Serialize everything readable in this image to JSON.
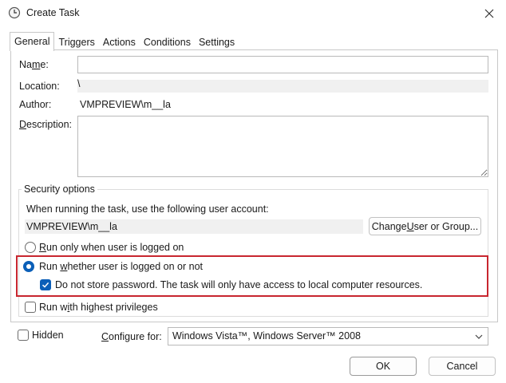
{
  "window": {
    "title": "Create Task"
  },
  "tabs": [
    {
      "label": "General",
      "active": true
    },
    {
      "label": "Triggers"
    },
    {
      "label": "Actions"
    },
    {
      "label": "Conditions"
    },
    {
      "label": "Settings"
    }
  ],
  "general": {
    "name_label_main": "Na",
    "name_label_mnemonic": "m",
    "name_label_rest": "e:",
    "name_value": "",
    "location_label": "Location:",
    "location_value": "\\",
    "author_label": "Author:",
    "author_value": "VMPREVIEW\\m__la",
    "description_label_mnemonic": "D",
    "description_label_rest": "escription:",
    "description_value": ""
  },
  "security": {
    "legend": "Security options",
    "account_prompt": "When running the task, use the following user account:",
    "account_value": "VMPREVIEW\\m__la",
    "change_btn": {
      "pre": "Change ",
      "mnemonic": "U",
      "post": "ser or Group..."
    },
    "opt_logged_on": {
      "mnemonic": "R",
      "rest": "un only when user is logged on",
      "selected": false
    },
    "opt_whether": {
      "pre": "Run ",
      "mnemonic": "w",
      "rest": "hether user is logged on or not",
      "selected": true
    },
    "opt_no_password": {
      "label": "Do not store password.  The task will only have access to local computer resources.",
      "checked": true
    },
    "opt_highest": {
      "pre": "Run w",
      "mnemonic": "i",
      "rest": "th highest privileges",
      "checked": false
    }
  },
  "hidden": {
    "label_mnemonic": "",
    "label": "Hidden",
    "checked": false
  },
  "configure": {
    "label_mnemonic": "C",
    "label_rest": "onfigure for:",
    "value": "Windows Vista™, Windows Server™ 2008"
  },
  "buttons": {
    "ok": "OK",
    "cancel": "Cancel"
  },
  "colors": {
    "accent": "#0b5fb8",
    "highlight": "#c8262f"
  }
}
